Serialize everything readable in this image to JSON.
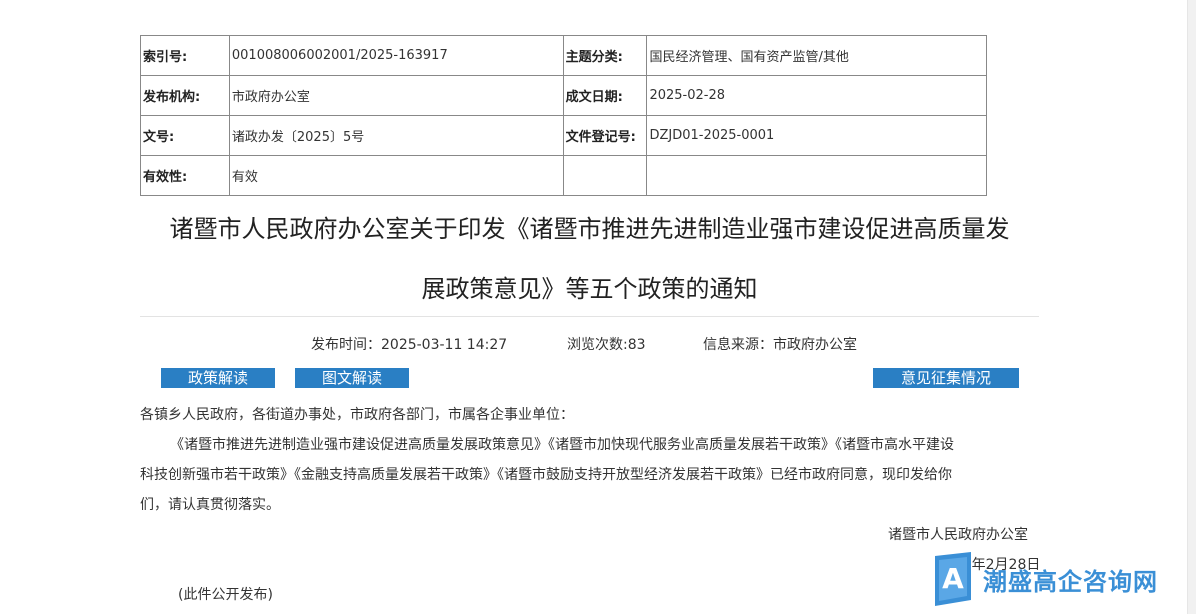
{
  "meta_table": {
    "index_label": "索引号:",
    "index_value": "001008006002001/2025-163917",
    "topic_label": "主题分类:",
    "topic_value": "国民经济管理、国有资产监管/其他",
    "publisher_label": "发布机构:",
    "publisher_value": "市政府办公室",
    "date_label": "成文日期:",
    "date_value": "2025-02-28",
    "docno_label": "文号:",
    "docno_value": "诸政办发〔2025〕5号",
    "regno_label": "文件登记号:",
    "regno_value": "DZJD01-2025-0001",
    "validity_label": "有效性:",
    "validity_value": "有效"
  },
  "title_line1": "诸暨市人民政府办公室关于印发《诸暨市推进先进制造业强市建设促进高质量发",
  "title_line2": "展政策意见》等五个政策的通知",
  "info": {
    "publish_time": "发布时间：2025-03-11 14:27",
    "views": "浏览次数:83",
    "source": "信息来源：市政府办公室"
  },
  "buttons": {
    "policy_interpretation": "政策解读",
    "graphic_interpretation": "图文解读",
    "feedback": "意见征集情况"
  },
  "body": {
    "salutation": "各镇乡人民政府，各街道办事处，市政府各部门，市属各企事业单位：",
    "para_line1": "《诸暨市推进先进制造业强市建设促进高质量发展政策意见》《诸暨市加快现代服务业高质量发展若干政策》《诸暨市高水平建设",
    "para_line2": "科技创新强市若干政策》《金融支持高质量发展若干政策》《诸暨市鼓励支持开放型经济发展若干政策》已经市政府同意，现印发给你",
    "para_line3": "们，请认真贯彻落实。",
    "signature": "诸暨市人民政府办公室",
    "sign_date": "2025年2月28日",
    "note": "(此件公开发布)"
  },
  "watermark": {
    "logo_letter": "A",
    "text": "潮盛高企咨询网"
  },
  "colors": {
    "button_bg": "#2a7fc4",
    "watermark": "#3a8fd6"
  }
}
